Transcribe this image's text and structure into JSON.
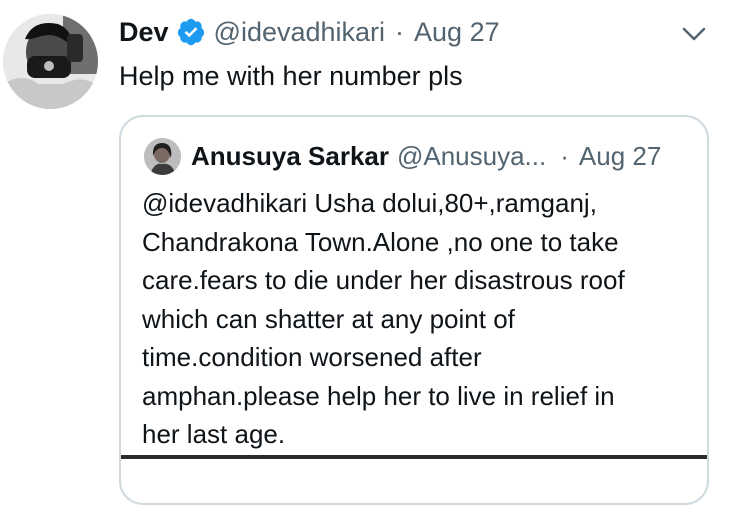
{
  "tweet": {
    "avatar_icon": "user-avatar-photo",
    "display_name": "Dev",
    "verified_icon": "verified-badge-icon",
    "handle": "@idevadhikari",
    "separator": "·",
    "date": "Aug 27",
    "more_icon": "chevron-down-icon",
    "text": "Help me with her number pls"
  },
  "quoted_tweet": {
    "avatar_icon": "user-avatar-photo",
    "display_name": "Anusuya Sarkar",
    "handle": "@Anusuya...",
    "separator": "·",
    "date": "Aug 27",
    "text_lines": [
      "@idevadhikari Usha dolui,80+,ramganj,",
      "Chandrakona Town.Alone ,no one to take",
      "care.fears to die under her disastrous roof",
      "which can shatter at any point of",
      "time.condition worsened after",
      "amphan.please help her to live in relief in",
      "her last age."
    ]
  },
  "colors": {
    "text_primary": "#0f1419",
    "text_secondary": "#536471",
    "verified_blue": "#1d9bf0",
    "border": "#cfd9de"
  }
}
